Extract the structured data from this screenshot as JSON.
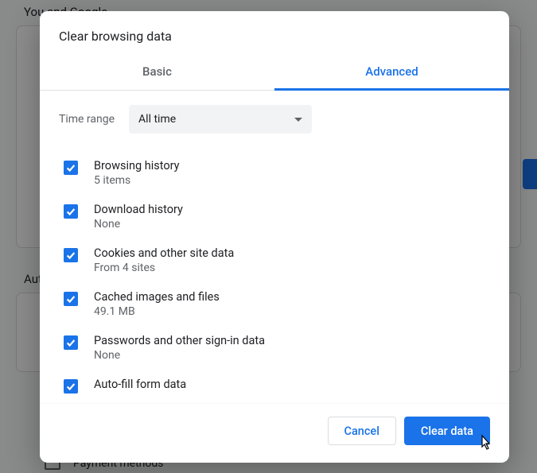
{
  "background": {
    "section1_title": "You and Google",
    "section2_title": "Aut",
    "payment_label": "Payment methods"
  },
  "dialog": {
    "title": "Clear browsing data",
    "tabs": {
      "basic": "Basic",
      "advanced": "Advanced"
    },
    "time_range_label": "Time range",
    "time_range_value": "All time",
    "items": [
      {
        "title": "Browsing history",
        "sub": "5 items",
        "checked": true
      },
      {
        "title": "Download history",
        "sub": "None",
        "checked": true
      },
      {
        "title": "Cookies and other site data",
        "sub": "From 4 sites",
        "checked": true
      },
      {
        "title": "Cached images and files",
        "sub": "49.1 MB",
        "checked": true
      },
      {
        "title": "Passwords and other sign-in data",
        "sub": "None",
        "checked": true
      },
      {
        "title": "Auto-fill form data",
        "sub": "",
        "checked": true
      }
    ],
    "buttons": {
      "cancel": "Cancel",
      "clear": "Clear data"
    }
  },
  "colors": {
    "accent": "#1a73e8"
  }
}
